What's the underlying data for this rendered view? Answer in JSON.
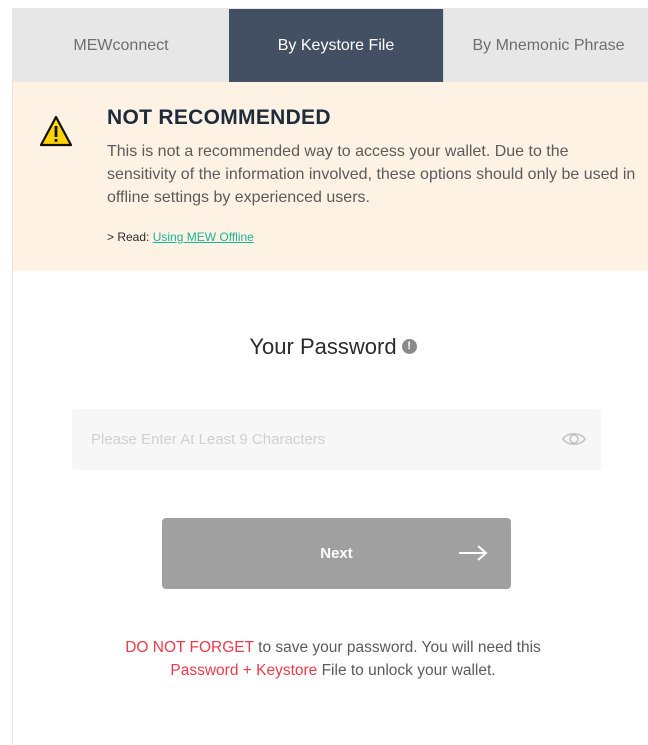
{
  "tabs": [
    {
      "label": "MEWconnect",
      "active": false
    },
    {
      "label": "By Keystore File",
      "active": true
    },
    {
      "label": "By Mnemonic Phrase",
      "active": false
    }
  ],
  "warning": {
    "icon": "warning-triangle-icon",
    "title": "NOT RECOMMENDED",
    "body": "This is not a recommended way to access your wallet. Due to the sensitivity of the information involved, these options should only be used in offline settings by experienced users.",
    "read_prefix": "> Read: ",
    "read_link": "Using MEW Offline"
  },
  "password": {
    "title": "Your Password",
    "info_icon": "info-icon",
    "placeholder": "Please Enter At Least 9 Characters",
    "value": "",
    "toggle_icon": "eye-icon"
  },
  "next_button": {
    "label": "Next",
    "icon": "arrow-right-icon"
  },
  "footer": {
    "line1_highlight": "DO NOT FORGET",
    "line1_rest": " to save your password. You will need this",
    "line2_highlight": "Password + Keystore",
    "line2_rest": " File to unlock your wallet."
  },
  "colors": {
    "active_tab": "#435063",
    "inactive_tab": "#e7e7e7",
    "warning_bg": "#fdf2e3",
    "link": "#1cb598",
    "button": "#a0a0a0",
    "alert_red": "#ee3a4a"
  }
}
